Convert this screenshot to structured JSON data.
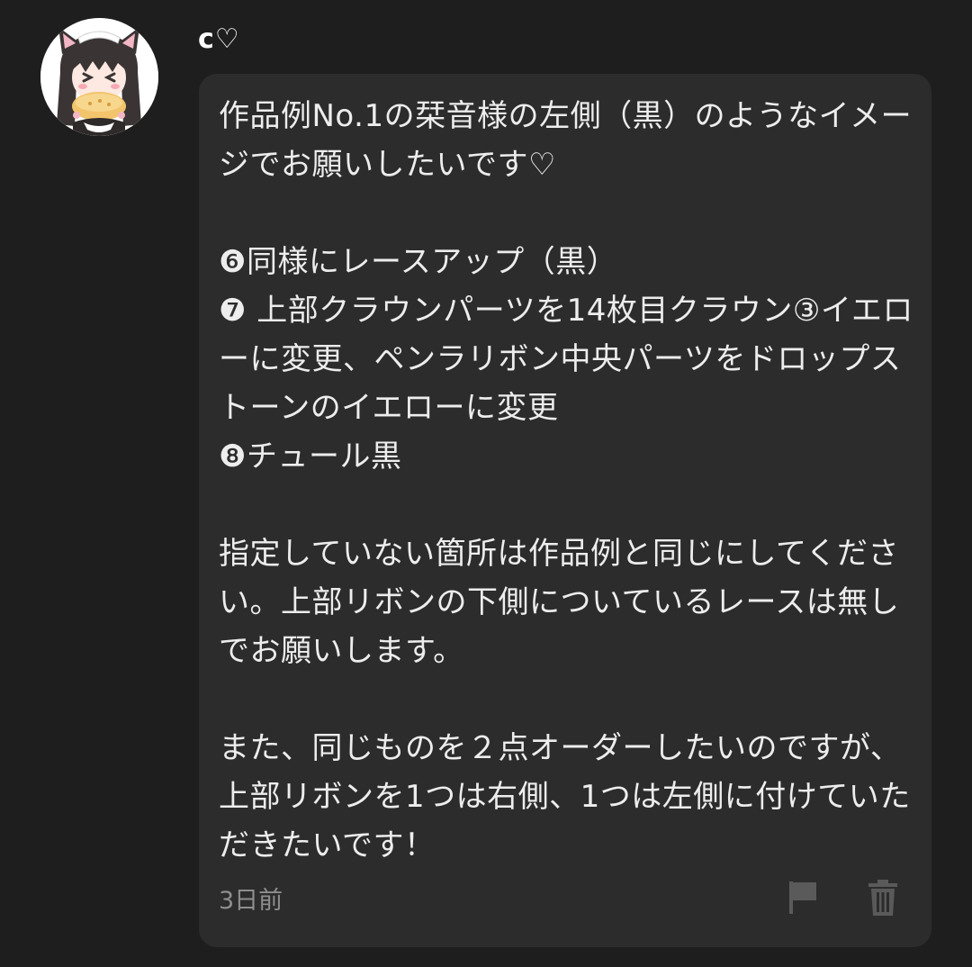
{
  "comment": {
    "username": "c♡",
    "message": "作品例No.1の栞音様の左側（黒）のようなイメージでお願いしたいです♡\n\n❻同様にレースアップ（黒）\n❼ 上部クラウンパーツを14枚目クラウン③イエローに変更、ペンラリボン中央パーツをドロップストーンのイエローに変更\n❽チュール黒\n\n指定していない箇所は作品例と同じにしてください。上部リボンの下側についているレースは無しでお願いします。\n\nまた、同じものを２点オーダーしたいのですが、上部リボンを1つは右側、1つは左側に付けていただきたいです！",
    "timestamp": "3日前",
    "icons": {
      "report": "flag-icon",
      "delete": "trash-icon"
    }
  },
  "colors": {
    "background": "#1e1e1e",
    "bubble": "#2c2c2c",
    "text": "#ededed",
    "muted": "#8e8e8e",
    "icon": "#5a5a5a"
  }
}
